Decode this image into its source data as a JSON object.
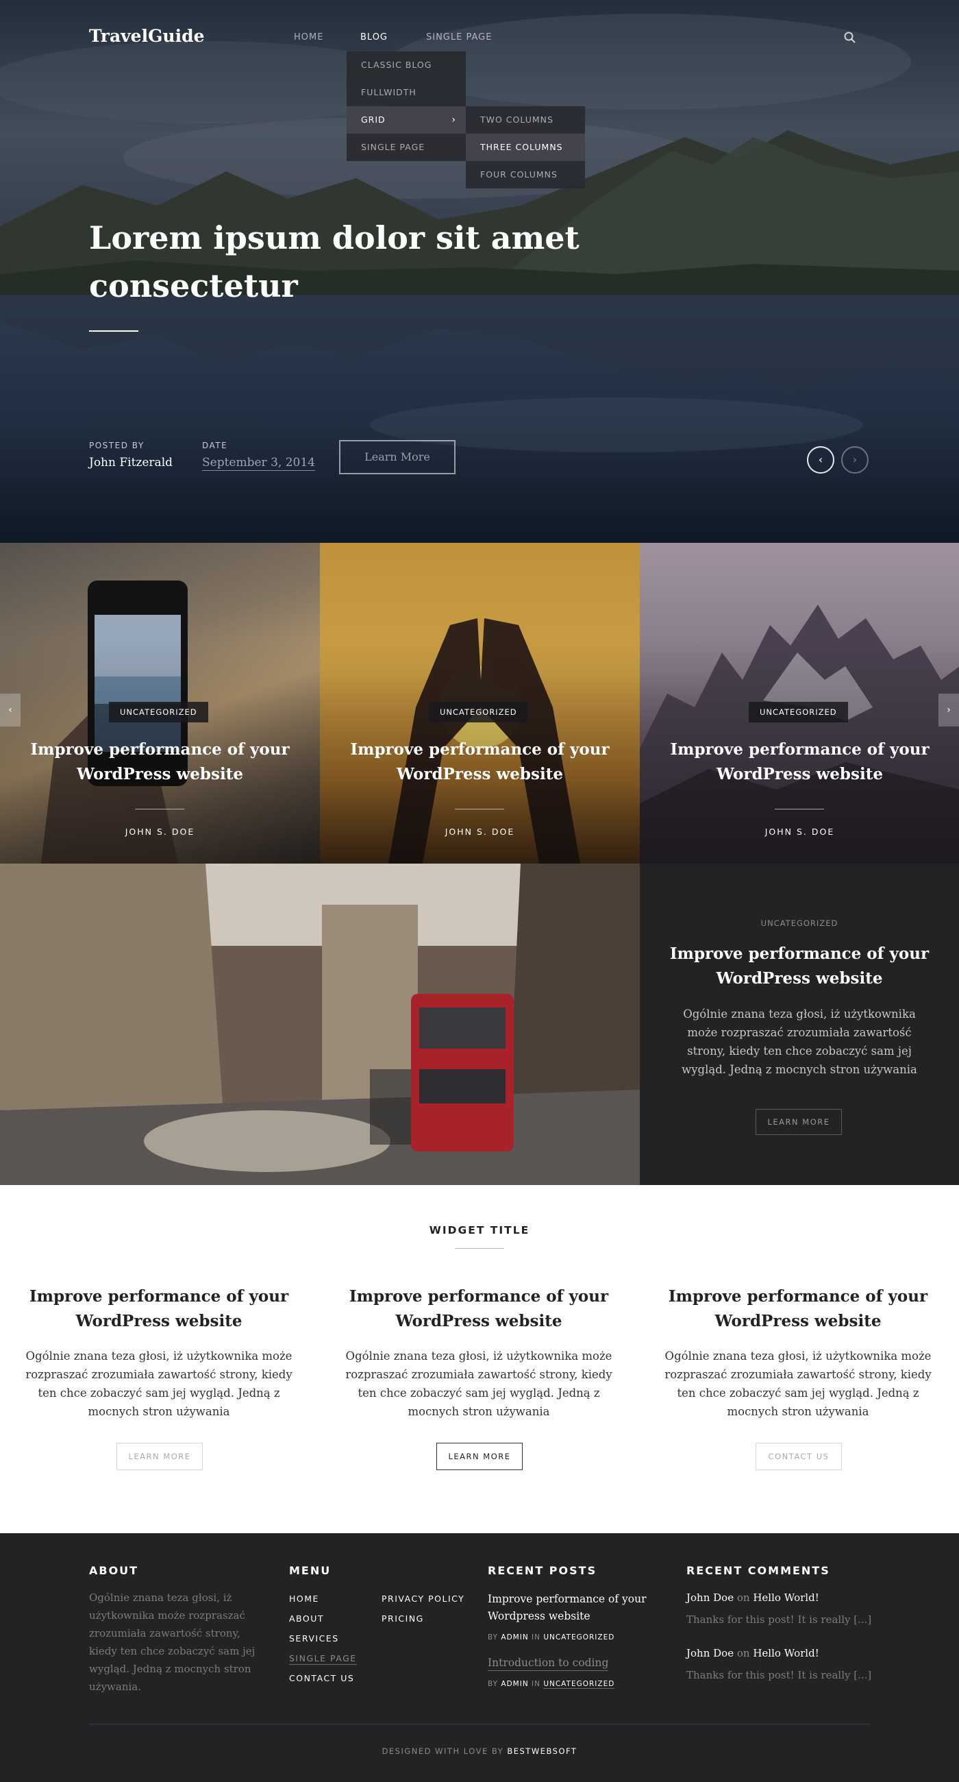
{
  "site": {
    "logo": "TravelGuide"
  },
  "nav": {
    "items": [
      "HOME",
      "BLOG",
      "SINGLE PAGE"
    ],
    "blog_dropdown": [
      "CLASSIC BLOG",
      "FULLWIDTH",
      "GRID",
      "SINGLE PAGE"
    ],
    "grid_submenu": [
      "TWO COLUMNS",
      "THREE COLUMNS",
      "FOUR COLUMNS"
    ]
  },
  "hero": {
    "title": "Lorem ipsum dolor sit amet consectetur",
    "posted_by_label": "POSTED BY",
    "posted_by": "John Fitzerald",
    "date_label": "DATE",
    "date": "September 3, 2014",
    "button": "Learn More",
    "prev": "‹",
    "next": "›"
  },
  "tiles": [
    {
      "category": "UNCATEGORIZED",
      "title": "Improve performance of your WordPress website",
      "author": "JOHN S. DOE"
    },
    {
      "category": "UNCATEGORIZED",
      "title": "Improve performance of your WordPress website",
      "author": "JOHN S. DOE"
    },
    {
      "category": "UNCATEGORIZED",
      "title": "Improve performance of your WordPress website",
      "author": "JOHN S. DOE"
    }
  ],
  "carousel": {
    "prev": "‹",
    "next": "›"
  },
  "feature": {
    "category": "UNCATEGORIZED",
    "title": "Improve performance of your WordPress website",
    "text": "Ogólnie znana teza głosi, iż użytkownika może rozpraszać zrozumiała zawartość strony, kiedy ten chce zobaczyć sam jej wygląd. Jedną z mocnych stron używania",
    "button": "LEARN MORE"
  },
  "widget": {
    "title": "WIDGET TITLE",
    "columns": [
      {
        "title": "Improve performance of your WordPress website",
        "text": "Ogólnie znana teza głosi, iż użytkownika może rozpraszać zrozumiała zawartość strony, kiedy ten chce zobaczyć sam jej wygląd. Jedną z mocnych stron używania",
        "button": "LEARN MORE"
      },
      {
        "title": "Improve performance of your WordPress website",
        "text": "Ogólnie znana teza głosi, iż użytkownika może rozpraszać zrozumiała zawartość strony, kiedy ten chce zobaczyć sam jej wygląd. Jedną z mocnych stron używania",
        "button": "LEARN MORE"
      },
      {
        "title": "Improve performance of your WordPress website",
        "text": "Ogólnie znana teza głosi, iż użytkownika może rozpraszać zrozumiała zawartość strony, kiedy ten chce zobaczyć sam jej wygląd. Jedną z mocnych stron używania",
        "button": "CONTACT US"
      }
    ]
  },
  "footer": {
    "about": {
      "title": "ABOUT",
      "text": "Ogólnie znana teza głosi, iż użytkownika może rozpraszać zrozumiała zawartość strony, kiedy ten chce zobaczyć sam jej wygląd. Jedną z mocnych stron używania."
    },
    "menu": {
      "title": "MENU",
      "col1": [
        "HOME",
        "ABOUT",
        "SERVICES",
        "SINGLE PAGE",
        "CONTACT US"
      ],
      "col2": [
        "PRIVACY POLICY",
        "PRICING"
      ]
    },
    "recent_posts": {
      "title": "RECENT POSTS",
      "posts": [
        {
          "title": "Improve performance of your Wordpress website",
          "by": "BY",
          "author": "ADMIN",
          "in": "IN",
          "category": "UNCATEGORIZED"
        },
        {
          "title": "Introduction to coding",
          "by": "BY",
          "author": "ADMIN",
          "in": "IN",
          "category": "UNCATEGORIZED"
        }
      ]
    },
    "recent_comments": {
      "title": "RECENT COMMENTS",
      "comments": [
        {
          "author": "John Doe",
          "on": "on",
          "post": "Hello World!",
          "text": "Thanks for this post! It is really [...]"
        },
        {
          "author": "John Doe",
          "on": "on",
          "post": "Hello World!",
          "text": "Thanks for this post! It is really [...]"
        }
      ]
    },
    "credit_prefix": "DESIGNED WITH LOVE BY",
    "credit_brand": "BESTWEBSOFT"
  },
  "colors": {
    "dark_panel": "#222325",
    "footer_bg": "#222325",
    "accent_white": "#ffffff"
  }
}
